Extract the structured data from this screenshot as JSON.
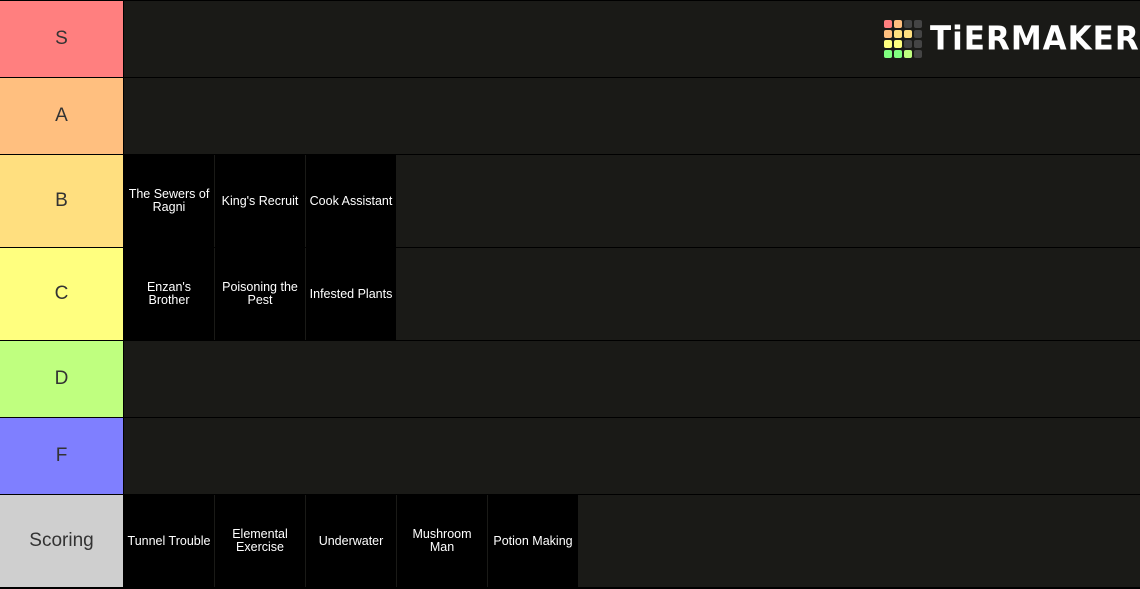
{
  "logo": {
    "text": "TiERMAKER",
    "grid_colors": [
      "#ff7f7f",
      "#ffbf7f",
      "#444444",
      "#444444",
      "#ffbf7f",
      "#ffdf7f",
      "#ffdf7f",
      "#444444",
      "#ffff7f",
      "#ffff7f",
      "#444444",
      "#444444",
      "#7fff7f",
      "#7fff7f",
      "#bfff7f",
      "#444444"
    ]
  },
  "tiers": [
    {
      "label": "S",
      "color": "#ff7f7f",
      "items": []
    },
    {
      "label": "A",
      "color": "#ffbf7f",
      "items": []
    },
    {
      "label": "B",
      "color": "#ffdf7f",
      "items": [
        "The Sewers of Ragni",
        "King's Recruit",
        "Cook Assistant"
      ]
    },
    {
      "label": "C",
      "color": "#ffff7f",
      "items": [
        "Enzan's Brother",
        "Poisoning the Pest",
        "Infested Plants"
      ]
    },
    {
      "label": "D",
      "color": "#bfff7f",
      "items": []
    },
    {
      "label": "F",
      "color": "#7f7fff",
      "items": []
    },
    {
      "label": "Scoring",
      "color": "#cfcfcf",
      "items": [
        "Tunnel Trouble",
        "Elemental Exercise",
        "Underwater",
        "Mushroom Man",
        "Potion Making"
      ]
    }
  ]
}
